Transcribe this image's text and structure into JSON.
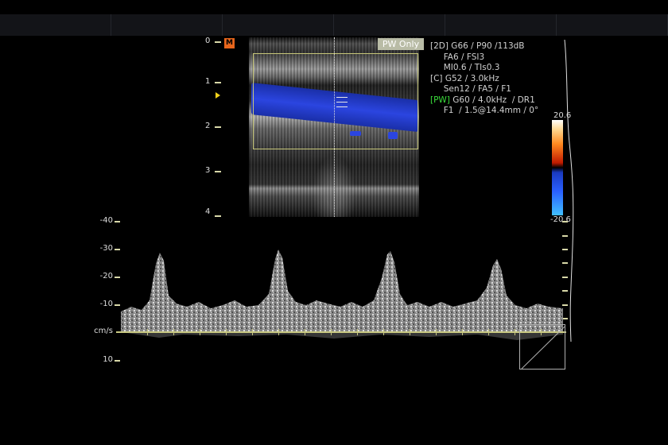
{
  "header": {
    "segments": 6
  },
  "bmode": {
    "badge": "PW Only",
    "marker_label": "M",
    "depth_labels": [
      "0",
      "1",
      "2",
      "3",
      "4"
    ]
  },
  "params": {
    "line1_tag": "[2D]",
    "line1": " G66 / P90 /113dB",
    "line2": "     FA6 / FSI3",
    "line3": "     MI0.6 / TIs0.3",
    "line4_tag": "[C]",
    "line4": " G52 / 3.0kHz",
    "line5": "     Sen12 / FA5 / F1",
    "line6_tag": "[PW]",
    "line6": " G60 / 4.0kHz  / DR1",
    "line7": "     F1  / 1.5@14.4mm / 0°"
  },
  "colors": {
    "accent_yellow": "#c8c882",
    "pw_green": "#3be03b",
    "flow_blue": "#2b45e0",
    "marker_orange": "#e8661c"
  },
  "colorbar": {
    "top_label": "20.6",
    "bottom_label": "-20.6"
  },
  "doppler": {
    "scale_labels": [
      "-40",
      "-30",
      "-20",
      "-10",
      "cm/s",
      "10"
    ],
    "unit": "cm/s"
  }
}
